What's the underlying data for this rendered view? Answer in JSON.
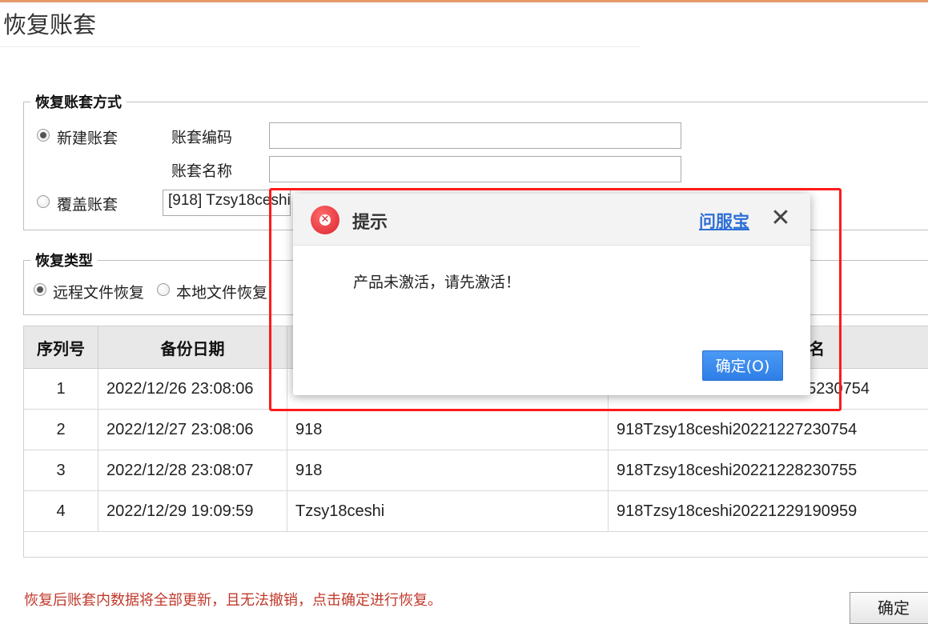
{
  "page": {
    "title": "恢复账套"
  },
  "method_group": {
    "legend": "恢复账套方式",
    "new_option": {
      "label": "新建账套",
      "checked": true
    },
    "code_label": "账套编码",
    "code_value": "",
    "name_label": "账套名称",
    "name_value": "",
    "overwrite_option": {
      "label": "覆盖账套",
      "checked": false
    },
    "overwrite_value": "[918] Tzsy18ceshi"
  },
  "type_group": {
    "legend": "恢复类型",
    "options": [
      {
        "label": "远程文件恢复",
        "checked": true
      },
      {
        "label": "本地文件恢复",
        "checked": false
      }
    ]
  },
  "table": {
    "headers": [
      "序列号",
      "备份日期",
      "",
      "名"
    ],
    "rows": [
      {
        "seq": "1",
        "date": "2022/12/26 23:08:06",
        "name": "",
        "file": "5230754"
      },
      {
        "seq": "2",
        "date": "2022/12/27 23:08:06",
        "name": "918",
        "file": "918Tzsy18ceshi20221227230754"
      },
      {
        "seq": "3",
        "date": "2022/12/28 23:08:07",
        "name": "918",
        "file": "918Tzsy18ceshi20221228230755"
      },
      {
        "seq": "4",
        "date": "2022/12/29 19:09:59",
        "name": "Tzsy18ceshi",
        "file": "918Tzsy18ceshi20221229190959"
      }
    ]
  },
  "footer": {
    "note": "恢复后账套内数据将全部更新，且无法撤销，点击确定进行恢复。",
    "confirm_label": "确定"
  },
  "dialog": {
    "title": "提示",
    "help_link": "问服宝",
    "close_symbol": "✕",
    "message": "产品未激活，请先激活！",
    "ok_label": "确定(O)",
    "icon": "error-icon"
  },
  "colors": {
    "highlight_frame": "#ff1a1a",
    "ok_button": "#2f7ee6",
    "link": "#2d6fd6",
    "warning_text": "#c0392b"
  }
}
